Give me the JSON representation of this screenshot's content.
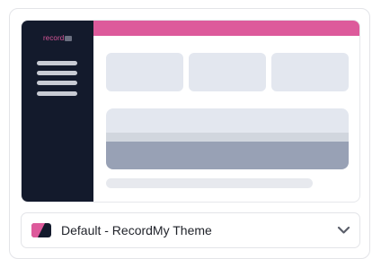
{
  "preview": {
    "logo_text": "record",
    "colors": {
      "sidebar": "#131a2c",
      "accent": "#dd5a9b",
      "tile": "#e3e7ef",
      "panel_bottom": "#98a1b5"
    }
  },
  "theme_select": {
    "selected_label": "Default - RecordMy Theme",
    "swatch_colors": [
      "#dd5a9b",
      "#131a2c"
    ],
    "icon": "chevron-down-icon"
  }
}
